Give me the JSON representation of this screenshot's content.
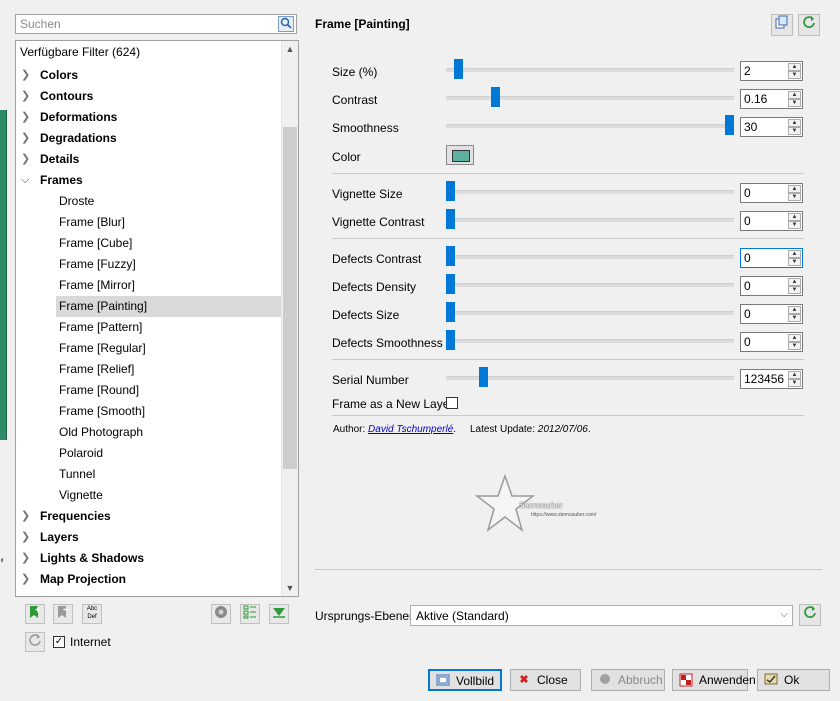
{
  "search": {
    "placeholder": "Suchen"
  },
  "tree": {
    "header": "Verfügbare Filter (624)",
    "items": [
      {
        "label": "Colors",
        "expanded": false
      },
      {
        "label": "Contours",
        "expanded": false
      },
      {
        "label": "Deformations",
        "expanded": false
      },
      {
        "label": "Degradations",
        "expanded": false
      },
      {
        "label": "Details",
        "expanded": false
      },
      {
        "label": "Frames",
        "expanded": true
      },
      {
        "label": "Frequencies",
        "expanded": false
      },
      {
        "label": "Layers",
        "expanded": false
      },
      {
        "label": "Lights & Shadows",
        "expanded": false
      },
      {
        "label": "Map Projection",
        "expanded": false
      }
    ],
    "frames_children": [
      "Droste",
      "Frame [Blur]",
      "Frame [Cube]",
      "Frame [Fuzzy]",
      "Frame [Mirror]",
      "Frame [Painting]",
      "Frame [Pattern]",
      "Frame [Regular]",
      "Frame [Relief]",
      "Frame [Round]",
      "Frame [Smooth]",
      "Old Photograph",
      "Polaroid",
      "Tunnel",
      "Vignette"
    ],
    "selected": "Frame [Painting]"
  },
  "bottom_left": {
    "internet_label": "Internet",
    "internet_checked": true
  },
  "panel": {
    "title": "Frame [Painting]",
    "params": {
      "size": {
        "label": "Size (%)",
        "value": "2",
        "level": 0.03
      },
      "contrast": {
        "label": "Contrast",
        "value": "0.16",
        "level": 0.16
      },
      "smoothness": {
        "label": "Smoothness",
        "value": "30",
        "level": 1.0
      },
      "color": {
        "label": "Color",
        "hex": "#5fb0a0"
      },
      "vignette_size": {
        "label": "Vignette Size",
        "value": "0",
        "level": 0
      },
      "vignette_contrast": {
        "label": "Vignette Contrast",
        "value": "0",
        "level": 0
      },
      "defects_contrast": {
        "label": "Defects Contrast",
        "value": "0",
        "level": 0
      },
      "defects_density": {
        "label": "Defects Density",
        "value": "0",
        "level": 0
      },
      "defects_size": {
        "label": "Defects Size",
        "value": "0",
        "level": 0
      },
      "defects_smoothness": {
        "label": "Defects Smoothness",
        "value": "0",
        "level": 0
      },
      "serial_number": {
        "label": "Serial Number",
        "value": "123456",
        "level": 0.12
      },
      "new_layer": {
        "label": "Frame as a New Layer",
        "checked": false
      }
    },
    "author_prefix": "Author: ",
    "author_name": "David Tschumperlé",
    "author_suffix": ".",
    "update_prefix": "Latest Update: ",
    "update_date": "2012/07/06",
    "update_suffix": "."
  },
  "logo": {
    "text": "Sternsauber",
    "url": "https://www.sternsauber.com/"
  },
  "input_layers": {
    "label": "Ursprungs-Ebenen",
    "value": "Aktive (Standard)"
  },
  "buttons": {
    "fullscreen": "Vollbild",
    "close": "Close",
    "cancel": "Abbruch",
    "apply": "Anwenden",
    "ok": "Ok"
  },
  "colors": {
    "accent": "#0078d7",
    "swatch": "#5fb0a0"
  }
}
